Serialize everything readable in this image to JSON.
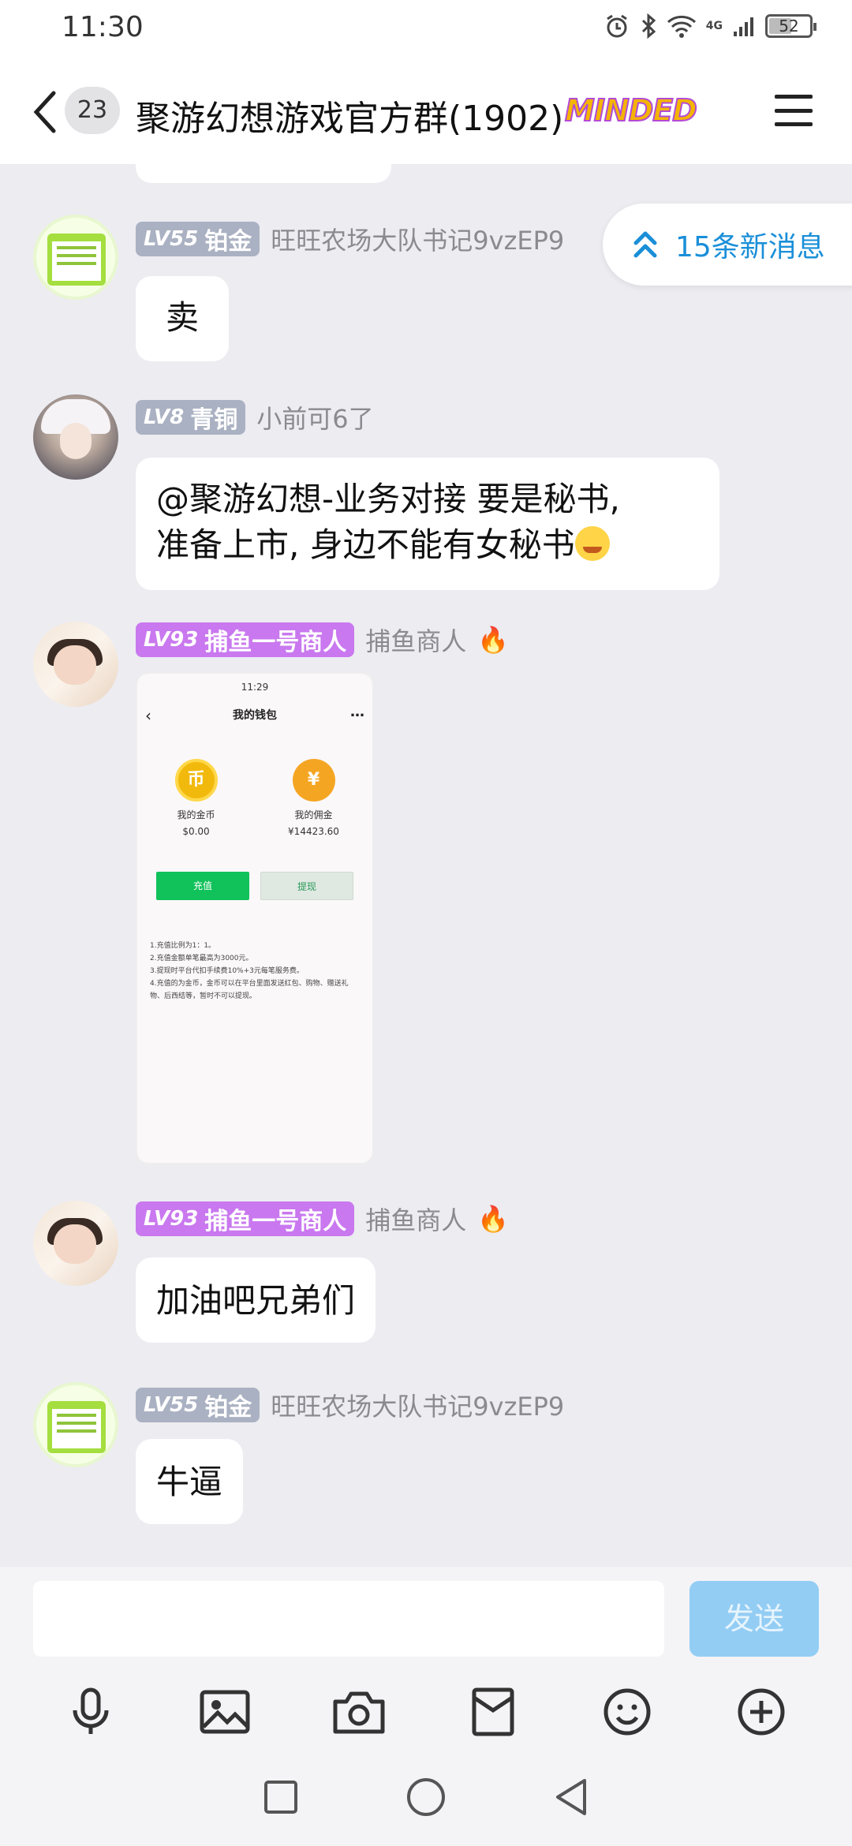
{
  "status_bar": {
    "time": "11:30",
    "battery": "52",
    "network": "4G"
  },
  "header": {
    "unread_count": "23",
    "title": "聚游幻想游戏官方群(1902)",
    "logo_text": "MINDED"
  },
  "new_messages": {
    "label": "15条新消息"
  },
  "messages": [
    {
      "level": "LV55",
      "rank": "铂金",
      "nickname": "旺旺农场大队书记9vzEP9",
      "text": "卖"
    },
    {
      "level": "LV8",
      "rank": "青铜",
      "nickname": "小前可6了",
      "text_line1": "@聚游幻想-业务对接 要是秘书,",
      "text_line2": "准备上市, 身边不能有女秘书"
    },
    {
      "level": "LV93",
      "rank": "捕鱼一号商人",
      "nickname": "捕鱼商人",
      "image": {
        "time": "11:29",
        "title": "我的钱包",
        "coin_label": "我的金币",
        "coin_value": "$0.00",
        "coin_symbol": "币",
        "commission_label": "我的佣金",
        "commission_value": "¥14423.60",
        "commission_symbol": "¥",
        "recharge_button": "充值",
        "withdraw_button": "提现",
        "rules": [
          "1.充值比例为1：1。",
          "2.充值金额单笔最高为3000元。",
          "3.提现时平台代扣手续费10%+3元每笔服务费。",
          "4.充值的为金币，金币可以在平台里面发送红包、购物、赠送礼物、后西结等，暂时不可以提现。"
        ]
      }
    },
    {
      "level": "LV93",
      "rank": "捕鱼一号商人",
      "nickname": "捕鱼商人",
      "text": "加油吧兄弟们"
    },
    {
      "level": "LV55",
      "rank": "铂金",
      "nickname": "旺旺农场大队书记9vzEP9",
      "text": "牛逼"
    }
  ],
  "composer": {
    "input_value": "",
    "send_label": "发送"
  },
  "colors": {
    "accent_blue": "#1a8fd8",
    "send_button": "#93cdf4",
    "badge_gray": "#aab1c2",
    "badge_purple": "#c978ef",
    "chat_bg": "#ececf1"
  },
  "icons": [
    "back-icon",
    "menu-icon",
    "double-chevron-up-icon",
    "microphone-icon",
    "image-icon",
    "camera-icon",
    "red-packet-icon",
    "emoji-icon",
    "plus-circle-icon",
    "nav-square-icon",
    "nav-circle-icon",
    "nav-back-icon",
    "fire-icon"
  ]
}
